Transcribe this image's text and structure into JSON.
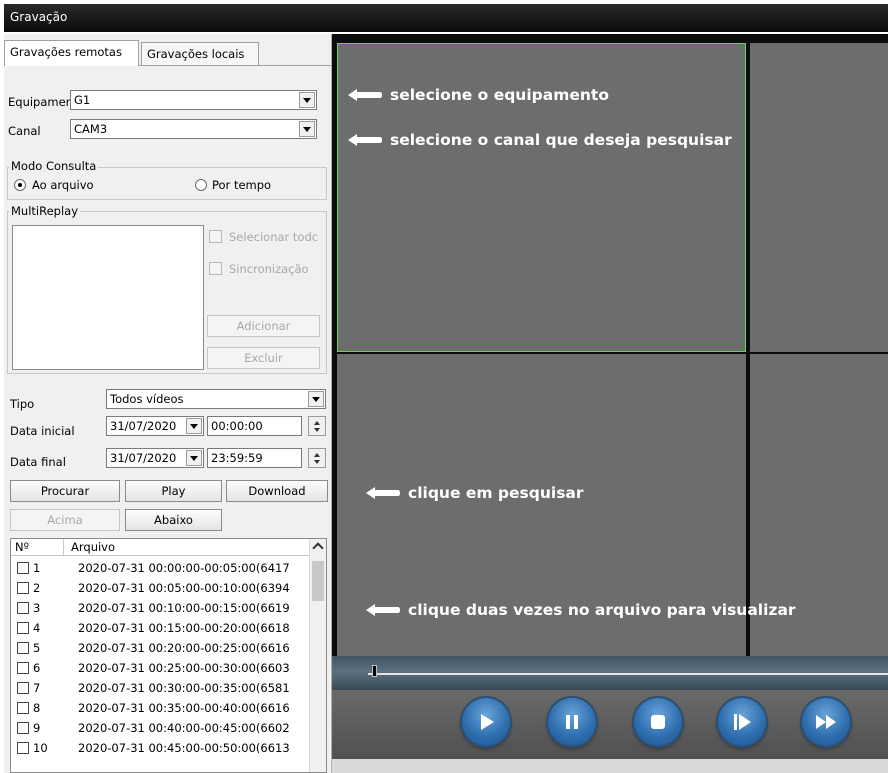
{
  "window": {
    "title": "Gravação"
  },
  "tabs": [
    {
      "label": "Gravações remotas",
      "active": true
    },
    {
      "label": "Gravações locais",
      "active": false
    }
  ],
  "device": {
    "label": "Equipamer",
    "value": "G1"
  },
  "channel": {
    "label": "Canal",
    "value": "CAM3"
  },
  "query_mode": {
    "title": "Modo Consulta",
    "option_file": "Ao arquivo",
    "option_time": "Por tempo",
    "selected": "Ao arquivo"
  },
  "multireplay": {
    "title": "MultiReplay",
    "select_all": "Selecionar todc",
    "sync": "Sincronização",
    "add": "Adicionar",
    "delete": "Excluir"
  },
  "filter": {
    "type_label": "Tipo",
    "type_value": "Todos vídeos",
    "start_label": "Data inicial",
    "start_date": "31/07/2020",
    "start_time": "00:00:00",
    "end_label": "Data final",
    "end_date": "31/07/2020",
    "end_time": "23:59:59"
  },
  "buttons": {
    "search": "Procurar",
    "play": "Play",
    "download": "Download",
    "up": "Acima",
    "down": "Abaixo"
  },
  "file_list": {
    "col_num": "Nº",
    "col_file": "Arquivo",
    "rows": [
      {
        "num": "1",
        "file": "2020-07-31 00:00:00-00:05:00(6417"
      },
      {
        "num": "2",
        "file": "2020-07-31 00:05:00-00:10:00(6394"
      },
      {
        "num": "3",
        "file": "2020-07-31 00:10:00-00:15:00(6619"
      },
      {
        "num": "4",
        "file": "2020-07-31 00:15:00-00:20:00(6618"
      },
      {
        "num": "5",
        "file": "2020-07-31 00:20:00-00:25:00(6616"
      },
      {
        "num": "6",
        "file": "2020-07-31 00:25:00-00:30:00(6603"
      },
      {
        "num": "7",
        "file": "2020-07-31 00:30:00-00:35:00(6581"
      },
      {
        "num": "8",
        "file": "2020-07-31 00:35:00-00:40:00(6616"
      },
      {
        "num": "9",
        "file": "2020-07-31 00:40:00-00:45:00(6602"
      },
      {
        "num": "10",
        "file": "2020-07-31 00:45:00-00:50:00(6613"
      }
    ]
  },
  "annotations": {
    "device": "selecione o equipamento",
    "channel": "selecione o canal que deseja pesquisar",
    "search": "clique em pesquisar",
    "file": "clique duas vezes no arquivo para visualizar"
  },
  "colors": {
    "selected_cell_border": "#58e04c",
    "control_button": "#2f6fb0"
  },
  "icons": [
    "play-icon",
    "pause-icon",
    "stop-icon",
    "step-forward-icon",
    "fast-forward-icon",
    "arrow-left-icon"
  ]
}
